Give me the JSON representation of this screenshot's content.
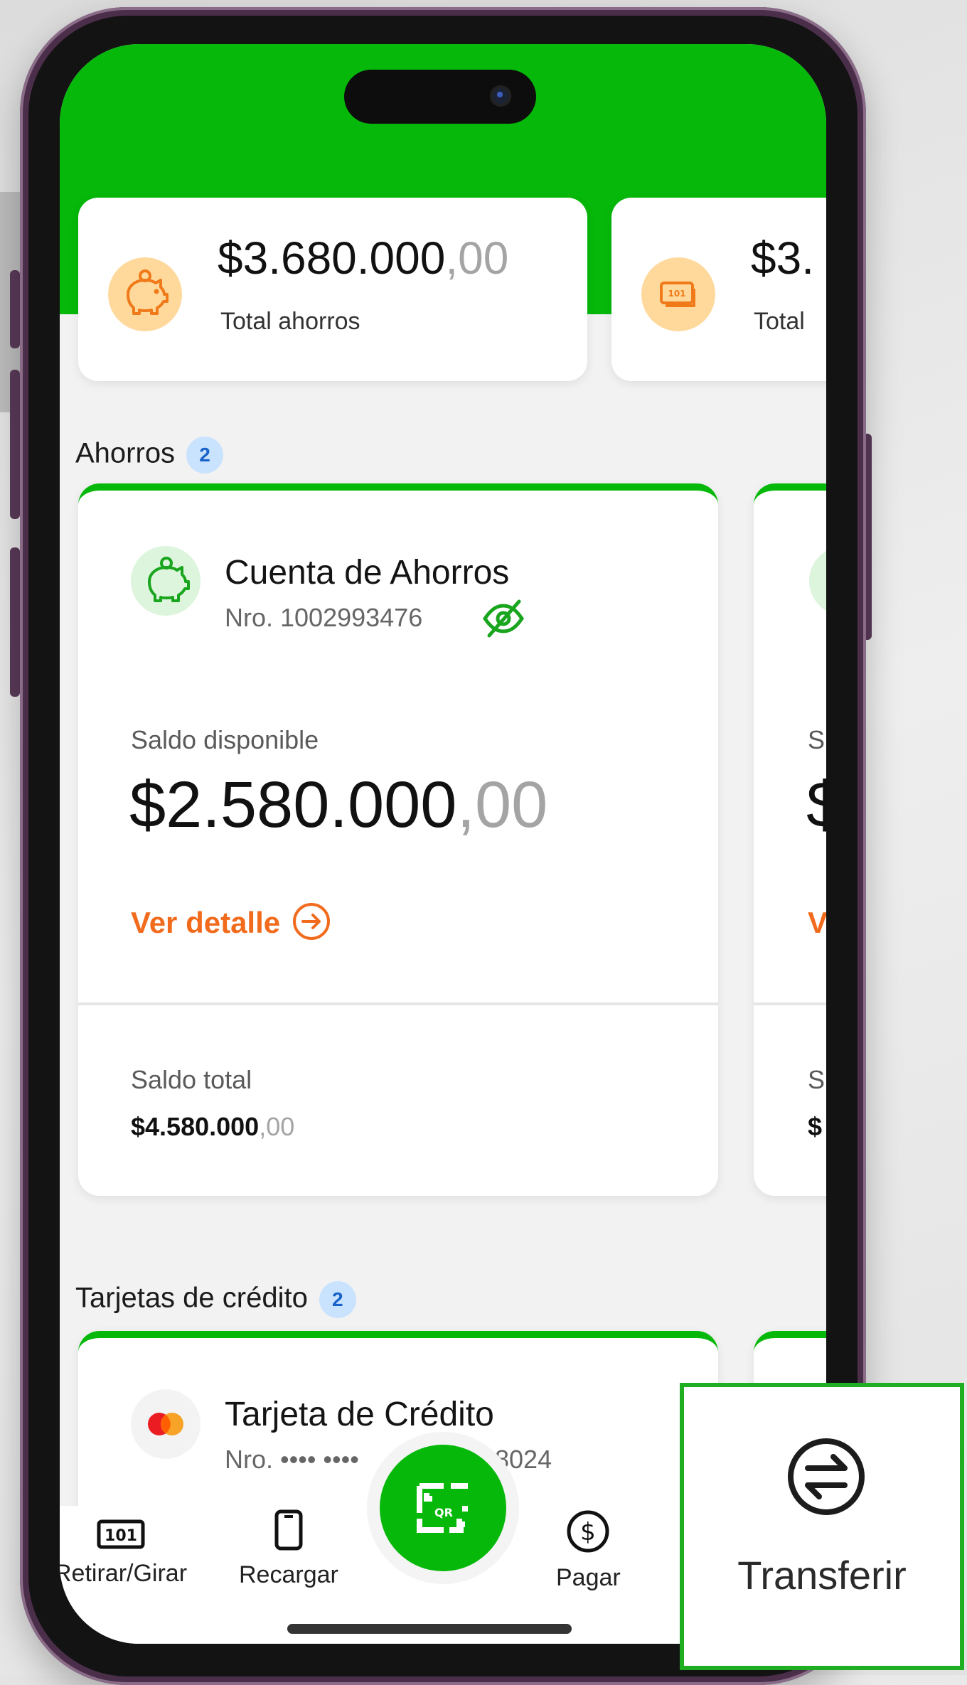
{
  "summary_cards": [
    {
      "amount_main": "$3.680.000",
      "amount_cents": ",00",
      "label": "Total ahorros",
      "icon": "piggy-bank-icon"
    },
    {
      "amount_main": "$3.",
      "amount_cents": "",
      "label": "Total",
      "icon": "cash-icon"
    }
  ],
  "sections": {
    "savings": {
      "title": "Ahorros",
      "count": "2"
    },
    "credit": {
      "title": "Tarjetas de crédito",
      "count": "2"
    }
  },
  "savings_account": {
    "title": "Cuenta de Ahorros",
    "number": "Nro. 1002993476",
    "available_label": "Saldo disponible",
    "available_main": "$2.580.000",
    "available_cents": ",00",
    "detail_link": "Ver detalle",
    "total_label": "Saldo total",
    "total_main": "$4.580.000",
    "total_cents": ",00"
  },
  "second_account_partial": {
    "label_a": "S",
    "amount_a": "$",
    "link_a": "V",
    "label_b": "S",
    "amount_b": "$"
  },
  "credit_card": {
    "title": "Tarjeta de Crédito",
    "number": "Nro. •••• ••••",
    "last4": "8024"
  },
  "bottom_nav": {
    "withdraw": "Retirar/Girar",
    "recharge": "Recargar",
    "pay": "Pagar"
  },
  "callout": {
    "label": "Transferir",
    "icon": "transfer-arrows-icon"
  },
  "colors": {
    "brand_green": "#06b80a",
    "accent_orange": "#f26b1d",
    "badge_blue": "#c9e3ff"
  }
}
